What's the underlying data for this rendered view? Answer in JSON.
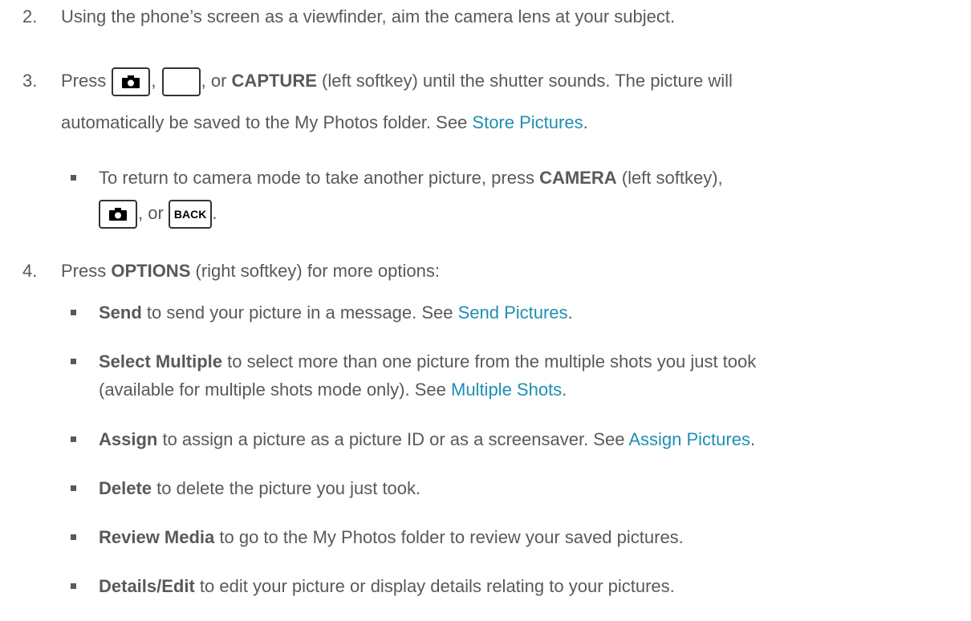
{
  "step2": {
    "number": "2.",
    "text": "Using the phone’s screen as a viewfinder, aim the camera lens at your subject."
  },
  "step3": {
    "number": "3.",
    "press": "Press",
    "comma1": ",",
    "comma2": ", or",
    "capture": "CAPTURE",
    "capture_after": " (left softkey) until the shutter sounds. The picture will",
    "line2": "automatically be saved to the My Photos folder. See ",
    "link": "Store Pictures",
    "period": ".",
    "bullet": {
      "text_before": "To return to camera mode to take another picture, press ",
      "camera": "CAMERA",
      "text_after": " (left softkey),",
      "or": ", or",
      "back_key": "BACK",
      "period": "."
    }
  },
  "step4": {
    "number": "4.",
    "press": "Press ",
    "options": "OPTIONS",
    "rest": " (right softkey) for more options:",
    "items": [
      {
        "bold": "Send",
        "text": " to send your picture in a message. See ",
        "link": "Send Pictures",
        "end": "."
      },
      {
        "bold": "Select Multiple",
        "text": " to select more than one picture from the multiple shots you just took",
        "line2": "(available for multiple shots mode only). See ",
        "link": "Multiple Shots",
        "end": "."
      },
      {
        "bold": "Assign",
        "text": " to assign a picture as a picture ID or as a screensaver. See ",
        "link": "Assign Pictures",
        "end": "."
      },
      {
        "bold": "Delete",
        "text": " to delete the picture you just took."
      },
      {
        "bold": "Review Media",
        "text": " to go to the My Photos folder to review your saved pictures."
      },
      {
        "bold": "Details/Edit",
        "text": " to edit your picture or display details relating to your pictures."
      }
    ]
  },
  "icons": {
    "camera_key": "camera-icon",
    "blank_key": "blank-key-icon",
    "bullet": "square-bullet-icon"
  },
  "colors": {
    "text": "#595959",
    "link": "#1f8fb3"
  }
}
